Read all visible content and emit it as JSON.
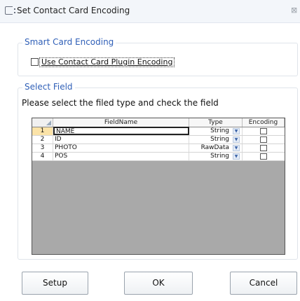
{
  "window": {
    "title": "Set Contact Card Encoding",
    "icon": "app-window-icon",
    "close_glyph": "⊠"
  },
  "smart_card": {
    "legend": "Smart Card Encoding",
    "checkbox_label": "Use Contact Card Plugin Encoding",
    "checked": false
  },
  "select_field": {
    "legend": "Select Field",
    "instruction": "Please select the filed type and check the field",
    "columns": {
      "field_name": "FieldName",
      "type": "Type",
      "encoding": "Encoding"
    },
    "rows": [
      {
        "num": "1",
        "field_name": "NAME",
        "type": "String",
        "encoding": false
      },
      {
        "num": "2",
        "field_name": "ID",
        "type": "String",
        "encoding": false
      },
      {
        "num": "3",
        "field_name": "PHOTO",
        "type": "RawData",
        "encoding": false
      },
      {
        "num": "4",
        "field_name": "POS",
        "type": "String",
        "encoding": false
      }
    ],
    "dropdown_glyph": "▼"
  },
  "buttons": {
    "setup": "Setup",
    "ok": "OK",
    "cancel": "Cancel"
  },
  "colors": {
    "legend_text": "#2f5fb7",
    "grid_empty": "#a9a9a9",
    "active_row_header": "#fbe3a8"
  }
}
